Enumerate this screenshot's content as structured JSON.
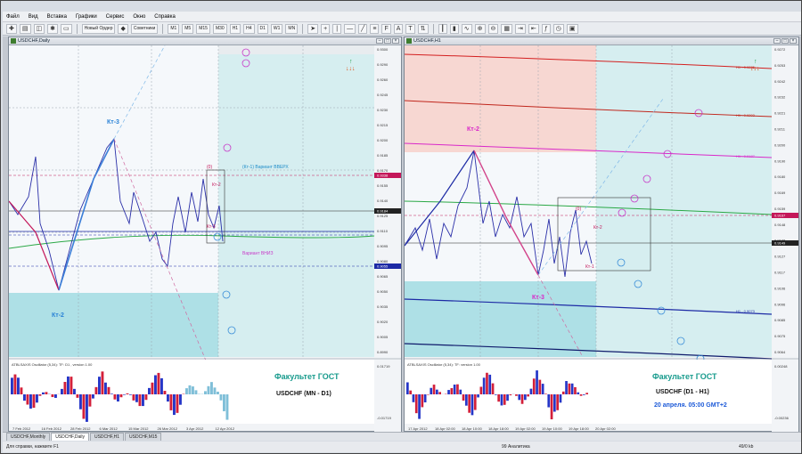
{
  "menu": [
    "Файл",
    "Вид",
    "Вставка",
    "Графики",
    "Сервис",
    "Окно",
    "Справка"
  ],
  "toolbar": {
    "new_order": "Новый Ордер",
    "advisors": "Советники",
    "timeframes": [
      "M1",
      "M5",
      "M15",
      "M30",
      "H1",
      "H4",
      "D1",
      "W1",
      "MN"
    ]
  },
  "left": {
    "title": "USDCHF,Daily",
    "labels": {
      "kt3": "Кт-3",
      "kt2": "Кт-2",
      "kt2s": "Кт-2",
      "kt3s": "Кт-3",
      "zero": "(0)",
      "up_variant": "(Кт-1) Вариант ВВЕРХ",
      "down_variant": "Вариант ВНИЗ",
      "faculty": "Факультет ГОСТ",
      "pair": "USDCHF (MN - D1)",
      "osc": "ATBLSAXIS Oscillator (5,34): TF: D1 , version 1.00"
    },
    "prices": [
      "0.9300",
      "0.9290",
      "0.9260",
      "0.9245",
      "0.9230",
      "0.9215",
      "0.9200",
      "0.9185",
      "0.9170",
      "0.9155",
      "0.9140",
      "0.9125",
      "0.9110",
      "0.9095",
      "0.9080",
      "0.9065",
      "0.9050",
      "0.9035",
      "0.9020",
      "0.9005",
      "0.8990"
    ],
    "marked_prices": {
      "red": "0.9338",
      "dark": "0.9184",
      "blue": "0.9055"
    },
    "dates": [
      "7 Feb 2012",
      "16 Feb 2012",
      "28 Feb 2012",
      "6 Mar 2012",
      "15 Mar 2012",
      "26 Mar 2012",
      "3 Apr 2012",
      "12 Apr 2012"
    ],
    "osc_values": [
      "0.01719",
      "-0.01719"
    ]
  },
  "right": {
    "title": "USDCHF,H1",
    "labels": {
      "kt2": "Кт-2",
      "kt3": "Кт-3",
      "kt2s": "Кт-2",
      "kt1s": "Кт-1",
      "zero": "(0)",
      "faculty": "Факультет ГОСТ",
      "pair": "USDCHF (D1 - H1)",
      "date": "20 апреля. 05:00 GMT+2",
      "osc": "ATBLSAXIS Oscillator (5,34): TF: version 1.00",
      "h1a": "H1 - 0.9235",
      "h1b": "H1 - 0.9203",
      "h1c": "H1 - 0.9187",
      "h1d": "H1 - 0.9073"
    },
    "prices": [
      "0.9272",
      "0.9253",
      "0.9242",
      "0.9232",
      "0.9221",
      "0.9211",
      "0.9200",
      "0.9190",
      "0.9180",
      "0.9169",
      "0.9159",
      "0.9148",
      "0.9138",
      "0.9127",
      "0.9117",
      "0.9106",
      "0.9096",
      "0.9085",
      "0.9075",
      "0.9064"
    ],
    "marked_prices": {
      "red": "0.9167",
      "dark": "0.9149"
    },
    "dates": [
      "17 Apr 2012",
      "18 Apr 02:00",
      "18 Apr 10:00",
      "18 Apr 18:00",
      "19 Apr 02:00",
      "19 Apr 10:00",
      "19 Apr 18:00",
      "20 Apr 02:00"
    ],
    "osc_values": [
      "0.00248",
      "-0.00236"
    ]
  },
  "tabs": [
    "USDCHF,Monthly",
    "USDCHF,Daily",
    "USDCHF,H1",
    "USDCHF,M15"
  ],
  "status": {
    "help": "Для справки, нажмите F1",
    "mid": "99 Аналитика",
    "right": "49/0 kb"
  },
  "colors": {
    "up": "#1d2aa5",
    "down": "#c4175a",
    "teal": "#1a9c8e",
    "cyan_zone": "#aee0e6",
    "pink_zone": "#f7d7d2"
  }
}
